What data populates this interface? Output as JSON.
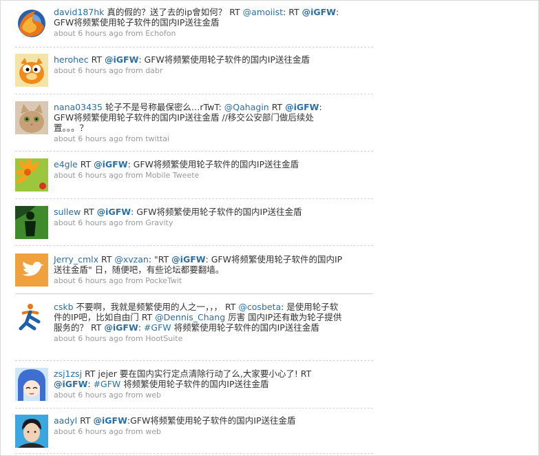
{
  "tweets": [
    {
      "user": "david187hk",
      "parts": [
        {
          "t": "text",
          "v": " 真的假的？送了去的ip會如何？ RT "
        },
        {
          "t": "mention",
          "v": "@amoiist"
        },
        {
          "t": "text",
          "v": ": RT "
        },
        {
          "t": "mentionb",
          "v": "@iGFW"
        },
        {
          "t": "text",
          "v": ": GFW将频繁使用轮子软件的国内IP送往金盾"
        }
      ],
      "meta": "about 6 hours ago from Echofon",
      "avatar": "firefox-avatar"
    },
    {
      "user": "herohec",
      "parts": [
        {
          "t": "text",
          "v": " RT "
        },
        {
          "t": "mentionb",
          "v": "@iGFW"
        },
        {
          "t": "text",
          "v": ": GFW将频繁使用轮子软件的国内IP送往金盾"
        }
      ],
      "meta": "about 6 hours ago from dabr",
      "avatar": "garfield-avatar"
    },
    {
      "user": "nana03435",
      "parts": [
        {
          "t": "text",
          "v": " 轮子不是号称最保密么…rTwT: "
        },
        {
          "t": "mention",
          "v": "@Qahagin"
        },
        {
          "t": "text",
          "v": " RT "
        },
        {
          "t": "mentionb",
          "v": "@iGFW"
        },
        {
          "t": "text",
          "v": ": GFW将频繁使用轮子软件的国内IP送往金盾 //移交公安部门做后续处置。。。？"
        }
      ],
      "meta": "about 6 hours ago from twittai",
      "avatar": "cat-avatar"
    },
    {
      "user": "e4gle",
      "parts": [
        {
          "t": "text",
          "v": " RT "
        },
        {
          "t": "mentionb",
          "v": "@iGFW"
        },
        {
          "t": "text",
          "v": ": GFW将频繁使用轮子软件的国内IP送往金盾"
        }
      ],
      "meta": "about 6 hours ago from Mobile Tweete",
      "avatar": "flower-avatar"
    },
    {
      "user": "sullew",
      "parts": [
        {
          "t": "text",
          "v": " RT "
        },
        {
          "t": "mentionb",
          "v": "@iGFW"
        },
        {
          "t": "text",
          "v": ": GFW将频繁使用轮子软件的国内IP送往金盾"
        }
      ],
      "meta": "about 6 hours ago from Gravity",
      "avatar": "green-figure-avatar"
    },
    {
      "user": "Jerry_cmlx",
      "parts": [
        {
          "t": "text",
          "v": " RT "
        },
        {
          "t": "mention",
          "v": "@xvzan"
        },
        {
          "t": "text",
          "v": ": \"RT "
        },
        {
          "t": "mentionb",
          "v": "@iGFW"
        },
        {
          "t": "text",
          "v": ": GFW将频繁使用轮子软件的国内IP送往金盾\" 日，随便吧，有些论坛都要翻墙。"
        }
      ],
      "meta": "about 6 hours ago from PockeTwit",
      "avatar": "twitter-bird-avatar"
    },
    {
      "user": "cskb",
      "parts": [
        {
          "t": "text",
          "v": " 不要啊，我就是频繁使用的人之一，，， RT "
        },
        {
          "t": "mention",
          "v": "@cosbeta"
        },
        {
          "t": "text",
          "v": ": 是使用轮子软件的IP吧，比如自由门 RT "
        },
        {
          "t": "mention",
          "v": "@Dennis_Chang"
        },
        {
          "t": "text",
          "v": " 厉害 国内IP还有敢为轮子提供服务的？ RT "
        },
        {
          "t": "mentionb",
          "v": "@iGFW"
        },
        {
          "t": "text",
          "v": ": "
        },
        {
          "t": "hash",
          "v": "#GFW"
        },
        {
          "t": "text",
          "v": " 将频繁使用轮子软件的国内IP送往金盾"
        }
      ],
      "meta": "about 6 hours ago from HootSuite",
      "avatar": "runner-logo-avatar"
    },
    {
      "user": "zsj1zsj",
      "parts": [
        {
          "t": "text",
          "v": " RT jejer 要在国内实行定点清除行动了么,大家要小心了! RT "
        },
        {
          "t": "mentionb",
          "v": "@iGFW"
        },
        {
          "t": "text",
          "v": ": "
        },
        {
          "t": "hash",
          "v": "#GFW"
        },
        {
          "t": "text",
          "v": " 将频繁使用轮子软件的国内IP送往金盾"
        }
      ],
      "meta": "about 6 hours ago from web",
      "avatar": "anime-girl-avatar"
    },
    {
      "user": "aadyl",
      "parts": [
        {
          "t": "text",
          "v": " RT "
        },
        {
          "t": "mentionb",
          "v": "@iGFW"
        },
        {
          "t": "text",
          "v": ":GFW将频繁使用轮子软件的国内IP送往金盾"
        }
      ],
      "meta": "about 6 hours ago from web",
      "avatar": "person-photo-avatar"
    }
  ]
}
